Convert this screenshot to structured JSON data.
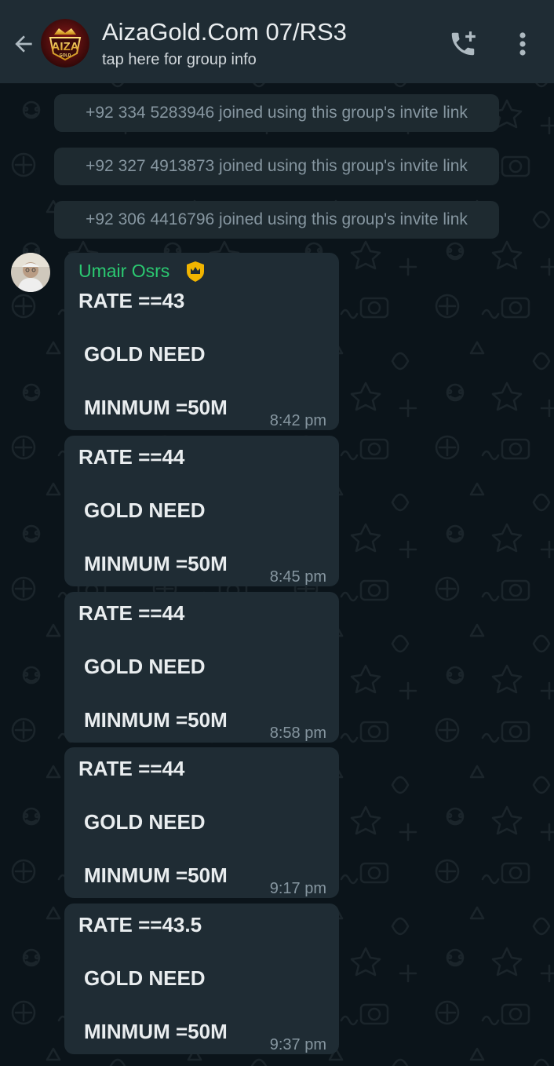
{
  "header": {
    "title": "AizaGold.Com 07/RS3",
    "subtitle": "tap here for group info",
    "avatar_text": "AIZA",
    "avatar_subtext": "GOLD"
  },
  "system_messages": [
    "+92 334 5283946 joined using this group's invite link",
    "+92 327 4913873 joined using this group's invite link",
    "+92 306 4416796 joined using this group's invite link"
  ],
  "sender": {
    "name": "Umair Osrs",
    "name_color": "#2bc971"
  },
  "messages": [
    {
      "rate": "RATE ==43",
      "gold": "GOLD NEED",
      "min": "MINMUM =50M",
      "time": "8:42 pm"
    },
    {
      "rate": "RATE ==44",
      "gold": "GOLD NEED",
      "min": "MINMUM =50M",
      "time": "8:45 pm"
    },
    {
      "rate": "RATE ==44",
      "gold": "GOLD NEED",
      "min": "MINMUM =50M",
      "time": "8:58 pm"
    },
    {
      "rate": "RATE ==44",
      "gold": "GOLD NEED",
      "min": "MINMUM =50M",
      "time": "9:17 pm"
    },
    {
      "rate": "RATE ==43.5",
      "gold": "GOLD NEED",
      "min": "MINMUM =50M",
      "time": "9:37 pm"
    }
  ],
  "colors": {
    "header_bg": "#1f2c34",
    "chat_bg": "#0b141a",
    "bubble_bg": "#1f2c34",
    "system_bg": "#1e2a30",
    "text": "#e9edef",
    "muted_text": "#8696a0",
    "accent_green": "#2bc971",
    "admin_badge": "#f0b400"
  },
  "icons": {
    "back": "arrow-left-icon",
    "call": "add-call-icon",
    "menu": "more-vertical-icon",
    "admin_badge": "crown-shield-icon"
  }
}
